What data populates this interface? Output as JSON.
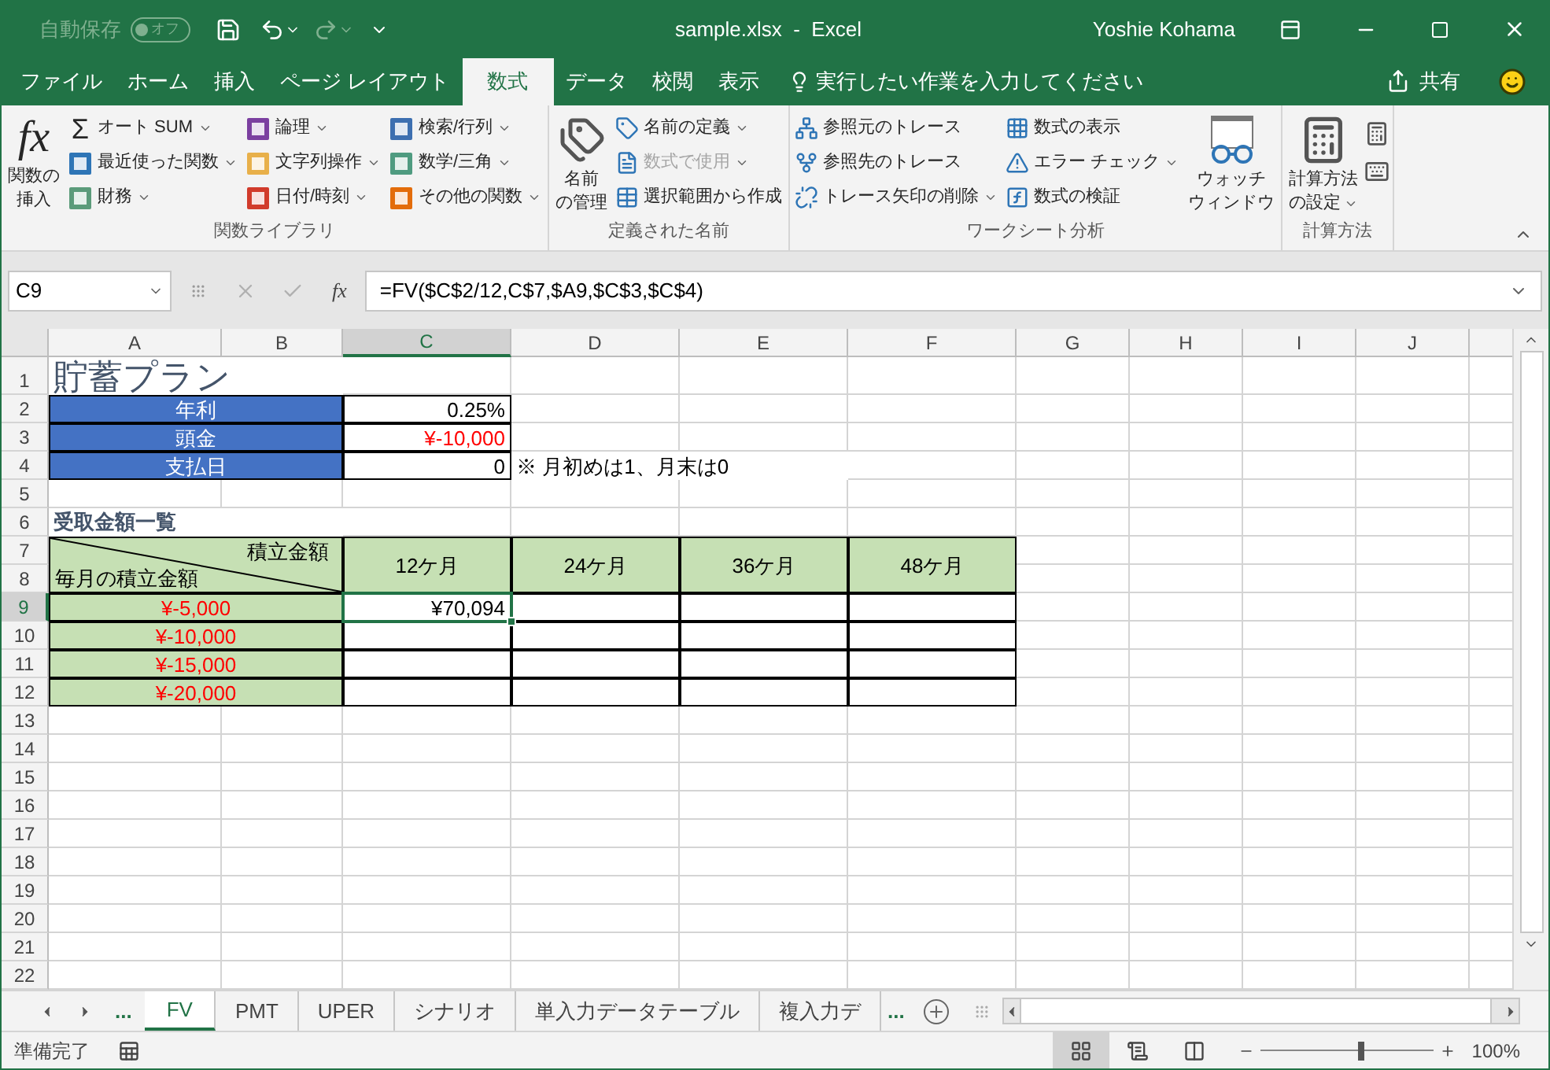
{
  "titlebar": {
    "autosave_label": "自動保存",
    "autosave_toggle": {
      "label": "オフ",
      "on": false
    },
    "redo_disabled": true,
    "title": "sample.xlsx  -  Excel",
    "user": "Yoshie Kohama"
  },
  "menu_tabs": [
    {
      "label": "ファイル",
      "selected": false
    },
    {
      "label": "ホーム",
      "selected": false
    },
    {
      "label": "挿入",
      "selected": false
    },
    {
      "label": "ページ レイアウト",
      "selected": false
    },
    {
      "label": "数式",
      "selected": true
    },
    {
      "label": "データ",
      "selected": false
    },
    {
      "label": "校閲",
      "selected": false
    },
    {
      "label": "表示",
      "selected": false
    }
  ],
  "tell_me": "実行したい作業を入力してください",
  "share": "共有",
  "ribbon": {
    "groups": [
      {
        "label": "関数ライブラリ",
        "blocks": [
          {
            "kind": "large",
            "lines": [
              "関数の",
              "挿入"
            ],
            "icon_text": "fx"
          },
          {
            "kind": "column",
            "items": [
              {
                "label": "オート SUM",
                "dropdown": true,
                "icon_text": "Σ"
              },
              {
                "label": "最近使った関数",
                "dropdown": true,
                "color": "#2e75b6"
              },
              {
                "label": "財務",
                "dropdown": true,
                "color": "#5b9b7a"
              }
            ]
          },
          {
            "kind": "column",
            "items": [
              {
                "label": "論理",
                "dropdown": true,
                "color": "#7b3fa0"
              },
              {
                "label": "文字列操作",
                "dropdown": true,
                "color": "#e8b04a"
              },
              {
                "label": "日付/時刻",
                "dropdown": true,
                "color": "#d13b2b"
              }
            ]
          },
          {
            "kind": "column",
            "items": [
              {
                "label": "検索/行列",
                "dropdown": true,
                "color": "#3d6fb0"
              },
              {
                "label": "数学/三角",
                "dropdown": true,
                "color": "#4f9b80"
              },
              {
                "label": "その他の関数",
                "dropdown": true,
                "color": "#e36c0a"
              }
            ]
          }
        ]
      },
      {
        "label": "定義された名前",
        "blocks": [
          {
            "kind": "large",
            "lines": [
              "名前",
              "の管理"
            ]
          },
          {
            "kind": "column",
            "items": [
              {
                "label": "名前の定義",
                "dropdown": true,
                "disabled": false
              },
              {
                "label": "数式で使用",
                "dropdown": true,
                "disabled": true
              },
              {
                "label": "選択範囲から作成",
                "dropdown": false,
                "disabled": false
              }
            ]
          }
        ]
      },
      {
        "label": "ワークシート分析",
        "blocks": [
          {
            "kind": "column",
            "items": [
              {
                "label": "参照元のトレース",
                "dropdown": false
              },
              {
                "label": "参照先のトレース",
                "dropdown": false
              },
              {
                "label": "トレース矢印の削除",
                "dropdown": true
              }
            ]
          },
          {
            "kind": "column",
            "items": [
              {
                "label": "数式の表示",
                "dropdown": false
              },
              {
                "label": "エラー チェック",
                "dropdown": true
              },
              {
                "label": "数式の検証",
                "dropdown": false
              }
            ]
          },
          {
            "kind": "large",
            "lines": [
              "ウォッチ",
              "ウィンドウ"
            ]
          }
        ]
      },
      {
        "label": "計算方法",
        "blocks": [
          {
            "kind": "large",
            "lines": [
              "計算方法",
              "の設定"
            ],
            "dropdown": true
          },
          {
            "kind": "icon-stack"
          }
        ]
      }
    ]
  },
  "formula_bar": {
    "name_box": "C9",
    "fx": "fx",
    "formula": "=FV($C$2/12,C$7,$A9,$C$3,$C$4)"
  },
  "sheet": {
    "columns": [
      {
        "label": "A",
        "selected": false
      },
      {
        "label": "B",
        "selected": false
      },
      {
        "label": "C",
        "selected": true
      },
      {
        "label": "D",
        "selected": false
      },
      {
        "label": "E",
        "selected": false
      },
      {
        "label": "F",
        "selected": false
      },
      {
        "label": "G",
        "selected": false
      },
      {
        "label": "H",
        "selected": false
      },
      {
        "label": "I",
        "selected": false
      },
      {
        "label": "J",
        "selected": false
      }
    ],
    "rows": [
      {
        "header": "1",
        "selected": false,
        "cells": [
          {
            "kind": "title",
            "text": "貯蓄プラン",
            "selected": false
          }
        ]
      },
      {
        "header": "2",
        "selected": false,
        "cells": [
          {
            "kind": "label",
            "text": "年利",
            "selected": false
          },
          "",
          {
            "kind": "value",
            "text": "0.25%",
            "selected": false
          }
        ]
      },
      {
        "header": "3",
        "selected": false,
        "cells": [
          {
            "kind": "label",
            "text": "頭金",
            "selected": false
          },
          "",
          {
            "kind": "negative",
            "text": "¥-10,000",
            "selected": false
          }
        ]
      },
      {
        "header": "4",
        "selected": false,
        "cells": [
          {
            "kind": "label",
            "text": "支払日",
            "selected": false
          },
          "",
          {
            "kind": "value",
            "text": "0",
            "selected": false
          },
          {
            "kind": "note",
            "text": "※ 月初めは1、月末は0",
            "selected": false
          }
        ]
      },
      {
        "header": "5",
        "selected": false,
        "cells": []
      },
      {
        "header": "6",
        "selected": false,
        "cells": [
          {
            "kind": "section",
            "text": "受取金額一覧",
            "selected": false
          }
        ]
      },
      {
        "header": "7",
        "selected": false,
        "cells": [
          {
            "kind": "diag",
            "top_text": "積立金額",
            "bottom_text": "毎月の積立金額",
            "selected": false
          },
          "",
          {
            "kind": "header",
            "text": "12ケ月",
            "selected": false
          },
          {
            "kind": "header",
            "text": "24ケ月",
            "selected": false
          },
          {
            "kind": "header",
            "text": "36ケ月",
            "selected": false
          },
          {
            "kind": "header",
            "text": "48ケ月",
            "selected": false
          }
        ]
      },
      {
        "header": "8",
        "selected": false,
        "cells": []
      },
      {
        "header": "9",
        "selected": true,
        "cells": [
          {
            "kind": "row-label",
            "text": "¥-5,000",
            "selected": false
          },
          "",
          {
            "kind": "value",
            "text": "¥70,094",
            "selected": true
          }
        ]
      },
      {
        "header": "10",
        "selected": false,
        "cells": [
          {
            "kind": "row-label",
            "text": "¥-10,000",
            "selected": false
          }
        ]
      },
      {
        "header": "11",
        "selected": false,
        "cells": [
          {
            "kind": "row-label",
            "text": "¥-15,000",
            "selected": false
          }
        ]
      },
      {
        "header": "12",
        "selected": false,
        "cells": [
          {
            "kind": "row-label",
            "text": "¥-20,000",
            "selected": false
          }
        ]
      },
      {
        "header": "13",
        "selected": false,
        "cells": []
      },
      {
        "header": "14",
        "selected": false,
        "cells": []
      },
      {
        "header": "15",
        "selected": false,
        "cells": []
      },
      {
        "header": "16",
        "selected": false,
        "cells": []
      },
      {
        "header": "17",
        "selected": false,
        "cells": []
      },
      {
        "header": "18",
        "selected": false,
        "cells": []
      },
      {
        "header": "19",
        "selected": false,
        "cells": []
      },
      {
        "header": "20",
        "selected": false,
        "cells": []
      },
      {
        "header": "21",
        "selected": false,
        "cells": []
      },
      {
        "header": "22",
        "selected": false,
        "cells": []
      }
    ]
  },
  "sheet_tabs": {
    "more_left": "...",
    "tabs": [
      {
        "label": "FV",
        "selected": true
      },
      {
        "label": "PMT",
        "selected": false
      },
      {
        "label": "UPER",
        "selected": false
      },
      {
        "label": "シナリオ",
        "selected": false
      },
      {
        "label": "単入力データテーブル",
        "selected": false
      },
      {
        "label": "複入力デ",
        "selected": false
      }
    ],
    "more_right": "..."
  },
  "status_bar": {
    "status": "準備完了",
    "views": [
      {
        "kind": "normal",
        "selected": true
      },
      {
        "kind": "page-layout",
        "selected": false
      },
      {
        "kind": "page-break",
        "selected": false
      }
    ],
    "zoom": {
      "level": 0.58,
      "reading": "100%"
    }
  }
}
